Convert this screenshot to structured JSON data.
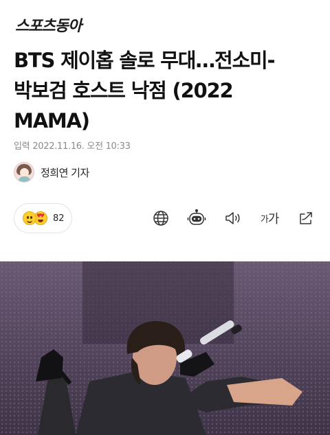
{
  "masthead": {
    "logo_text": "스포츠동아"
  },
  "article": {
    "headline_lines": [
      "BTS 제이홉 솔로 무대…전소미-",
      "박보검 호스트 낙점 (2022",
      "MAMA)"
    ],
    "date_label": "입력",
    "date_value": "2022.11.16. 오전 10:33",
    "author_name": "정희연 기자"
  },
  "reactions": {
    "count": "82",
    "icons": [
      "smile-emoji",
      "heart-eyes-emoji"
    ]
  },
  "toolbar": {
    "icons": [
      "globe-icon",
      "robot-icon",
      "speaker-icon",
      "font-size-icon",
      "share-icon"
    ],
    "font_size_label_small": "가",
    "font_size_label_large": "가"
  },
  "colors": {
    "photo_background": "#5a4a64",
    "date_text": "#8a8a8a"
  }
}
